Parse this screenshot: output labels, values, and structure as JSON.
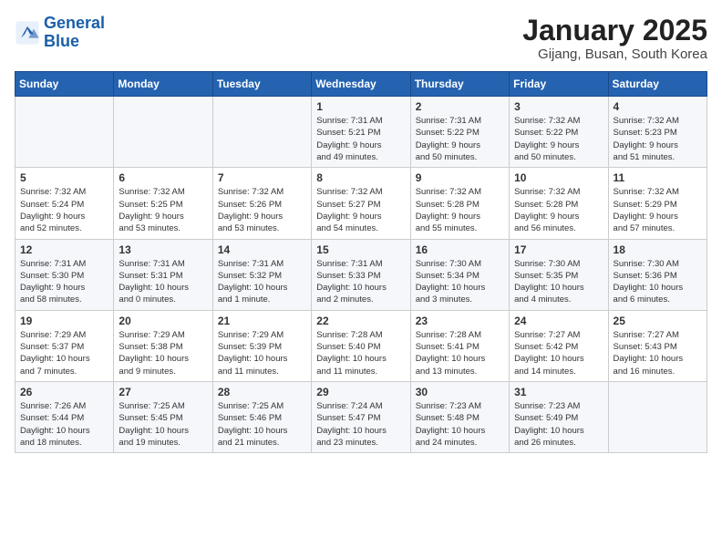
{
  "header": {
    "logo_line1": "General",
    "logo_line2": "Blue",
    "title": "January 2025",
    "subtitle": "Gijang, Busan, South Korea"
  },
  "weekdays": [
    "Sunday",
    "Monday",
    "Tuesday",
    "Wednesday",
    "Thursday",
    "Friday",
    "Saturday"
  ],
  "weeks": [
    [
      {
        "day": "",
        "info": ""
      },
      {
        "day": "",
        "info": ""
      },
      {
        "day": "",
        "info": ""
      },
      {
        "day": "1",
        "info": "Sunrise: 7:31 AM\nSunset: 5:21 PM\nDaylight: 9 hours\nand 49 minutes."
      },
      {
        "day": "2",
        "info": "Sunrise: 7:31 AM\nSunset: 5:22 PM\nDaylight: 9 hours\nand 50 minutes."
      },
      {
        "day": "3",
        "info": "Sunrise: 7:32 AM\nSunset: 5:22 PM\nDaylight: 9 hours\nand 50 minutes."
      },
      {
        "day": "4",
        "info": "Sunrise: 7:32 AM\nSunset: 5:23 PM\nDaylight: 9 hours\nand 51 minutes."
      }
    ],
    [
      {
        "day": "5",
        "info": "Sunrise: 7:32 AM\nSunset: 5:24 PM\nDaylight: 9 hours\nand 52 minutes."
      },
      {
        "day": "6",
        "info": "Sunrise: 7:32 AM\nSunset: 5:25 PM\nDaylight: 9 hours\nand 53 minutes."
      },
      {
        "day": "7",
        "info": "Sunrise: 7:32 AM\nSunset: 5:26 PM\nDaylight: 9 hours\nand 53 minutes."
      },
      {
        "day": "8",
        "info": "Sunrise: 7:32 AM\nSunset: 5:27 PM\nDaylight: 9 hours\nand 54 minutes."
      },
      {
        "day": "9",
        "info": "Sunrise: 7:32 AM\nSunset: 5:28 PM\nDaylight: 9 hours\nand 55 minutes."
      },
      {
        "day": "10",
        "info": "Sunrise: 7:32 AM\nSunset: 5:28 PM\nDaylight: 9 hours\nand 56 minutes."
      },
      {
        "day": "11",
        "info": "Sunrise: 7:32 AM\nSunset: 5:29 PM\nDaylight: 9 hours\nand 57 minutes."
      }
    ],
    [
      {
        "day": "12",
        "info": "Sunrise: 7:31 AM\nSunset: 5:30 PM\nDaylight: 9 hours\nand 58 minutes."
      },
      {
        "day": "13",
        "info": "Sunrise: 7:31 AM\nSunset: 5:31 PM\nDaylight: 10 hours\nand 0 minutes."
      },
      {
        "day": "14",
        "info": "Sunrise: 7:31 AM\nSunset: 5:32 PM\nDaylight: 10 hours\nand 1 minute."
      },
      {
        "day": "15",
        "info": "Sunrise: 7:31 AM\nSunset: 5:33 PM\nDaylight: 10 hours\nand 2 minutes."
      },
      {
        "day": "16",
        "info": "Sunrise: 7:30 AM\nSunset: 5:34 PM\nDaylight: 10 hours\nand 3 minutes."
      },
      {
        "day": "17",
        "info": "Sunrise: 7:30 AM\nSunset: 5:35 PM\nDaylight: 10 hours\nand 4 minutes."
      },
      {
        "day": "18",
        "info": "Sunrise: 7:30 AM\nSunset: 5:36 PM\nDaylight: 10 hours\nand 6 minutes."
      }
    ],
    [
      {
        "day": "19",
        "info": "Sunrise: 7:29 AM\nSunset: 5:37 PM\nDaylight: 10 hours\nand 7 minutes."
      },
      {
        "day": "20",
        "info": "Sunrise: 7:29 AM\nSunset: 5:38 PM\nDaylight: 10 hours\nand 9 minutes."
      },
      {
        "day": "21",
        "info": "Sunrise: 7:29 AM\nSunset: 5:39 PM\nDaylight: 10 hours\nand 11 minutes."
      },
      {
        "day": "22",
        "info": "Sunrise: 7:28 AM\nSunset: 5:40 PM\nDaylight: 10 hours\nand 11 minutes."
      },
      {
        "day": "23",
        "info": "Sunrise: 7:28 AM\nSunset: 5:41 PM\nDaylight: 10 hours\nand 13 minutes."
      },
      {
        "day": "24",
        "info": "Sunrise: 7:27 AM\nSunset: 5:42 PM\nDaylight: 10 hours\nand 14 minutes."
      },
      {
        "day": "25",
        "info": "Sunrise: 7:27 AM\nSunset: 5:43 PM\nDaylight: 10 hours\nand 16 minutes."
      }
    ],
    [
      {
        "day": "26",
        "info": "Sunrise: 7:26 AM\nSunset: 5:44 PM\nDaylight: 10 hours\nand 18 minutes."
      },
      {
        "day": "27",
        "info": "Sunrise: 7:25 AM\nSunset: 5:45 PM\nDaylight: 10 hours\nand 19 minutes."
      },
      {
        "day": "28",
        "info": "Sunrise: 7:25 AM\nSunset: 5:46 PM\nDaylight: 10 hours\nand 21 minutes."
      },
      {
        "day": "29",
        "info": "Sunrise: 7:24 AM\nSunset: 5:47 PM\nDaylight: 10 hours\nand 23 minutes."
      },
      {
        "day": "30",
        "info": "Sunrise: 7:23 AM\nSunset: 5:48 PM\nDaylight: 10 hours\nand 24 minutes."
      },
      {
        "day": "31",
        "info": "Sunrise: 7:23 AM\nSunset: 5:49 PM\nDaylight: 10 hours\nand 26 minutes."
      },
      {
        "day": "",
        "info": ""
      }
    ]
  ]
}
